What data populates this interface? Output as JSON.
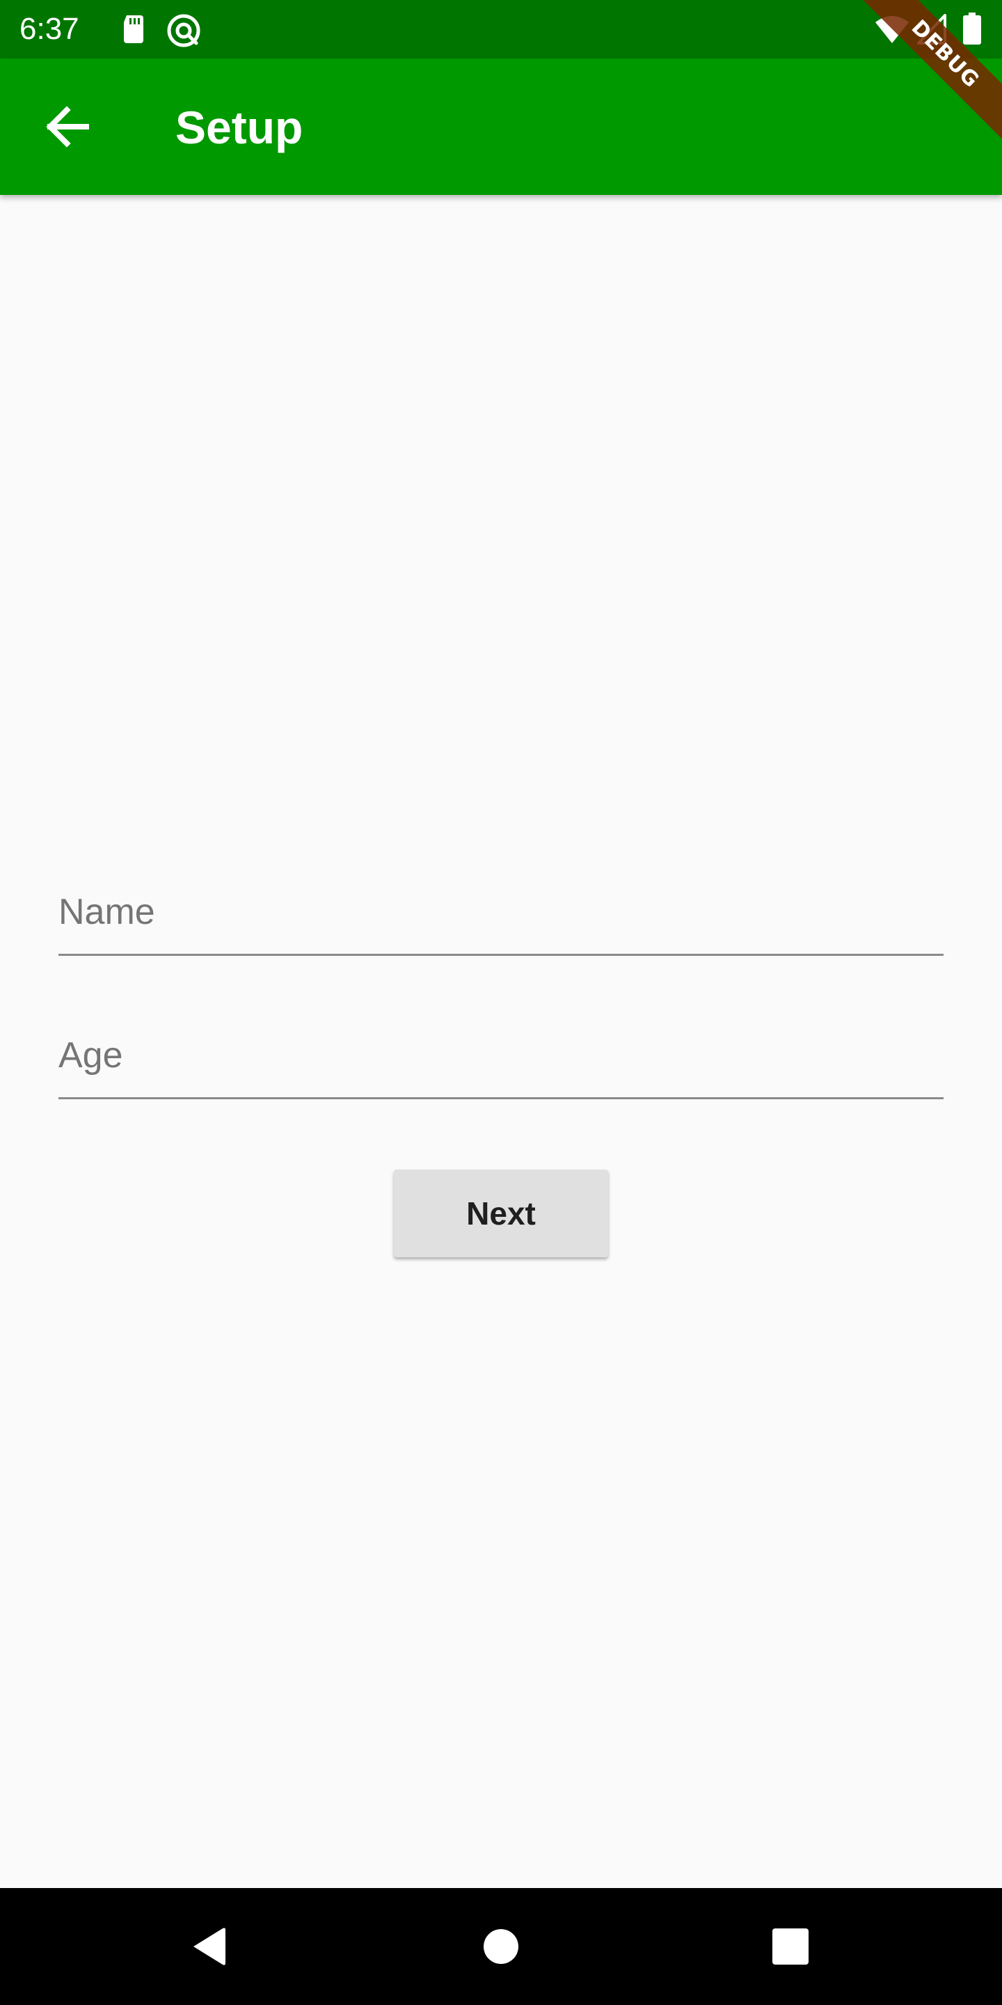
{
  "status_bar": {
    "time": "6:37",
    "left_icons": [
      "sd-card-icon",
      "at-sign-icon"
    ],
    "right_icons": [
      "wifi-icon",
      "cell-signal-icon",
      "battery-icon"
    ]
  },
  "app_bar": {
    "title": "Setup",
    "back_icon": "arrow-back-icon",
    "background": "#009900",
    "status_background": "#007600"
  },
  "debug_banner": {
    "label": "DEBUG"
  },
  "form": {
    "name_placeholder": "Name",
    "age_placeholder": "Age",
    "next_label": "Next"
  },
  "nav_bar": {
    "buttons": [
      "back-triangle-icon",
      "home-circle-icon",
      "recents-square-icon"
    ]
  }
}
